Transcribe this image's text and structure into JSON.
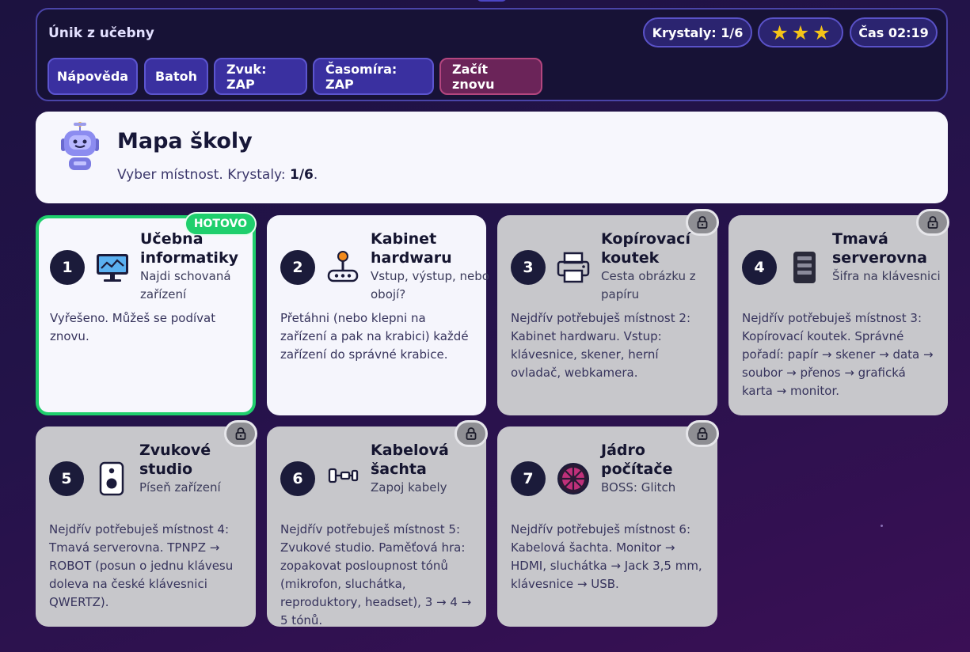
{
  "hud": {
    "title": "Únik z učebny",
    "crystals": "Krystaly: 1/6",
    "stars": [
      "★",
      "★",
      "★"
    ],
    "time": "Čas 02:19",
    "buttons": {
      "help": "Nápověda",
      "backpack": "Batoh",
      "sound": "Zvuk: ZAP",
      "timer": "Časomíra: ZAP",
      "restart": "Začít znovu"
    }
  },
  "intro": {
    "title": "Mapa školy",
    "text_prefix": "Vyber místnost. Krystaly: ",
    "text_value": "1/6",
    "text_suffix": "."
  },
  "rooms": [
    {
      "number": "1",
      "title": "Učebna informatiky",
      "subtitle": "Najdi schovaná zařízení",
      "body": "Vyřešeno. Můžeš se podívat znovu.",
      "status": "done",
      "badge": "HOTOVO",
      "icon": "monitor-icon"
    },
    {
      "number": "2",
      "title": "Kabinet hardwaru",
      "subtitle": "Vstup, výstup, nebo obojí?",
      "body": "Přetáhni (nebo klepni na zařízení a pak na krabici) každé zařízení do správné krabice.",
      "status": "open",
      "icon": "joystick-icon"
    },
    {
      "number": "3",
      "title": "Kopírovací koutek",
      "subtitle": "Cesta obrázku z papíru",
      "body": "Nejdřív potřebuješ místnost 2: Kabinet hardwaru. Vstup: klávesnice, skener, herní ovladač, webkamera.",
      "status": "locked",
      "icon": "printer-icon"
    },
    {
      "number": "4",
      "title": "Tmavá serverovna",
      "subtitle": "Šifra na klávesnici",
      "body": "Nejdřív potřebuješ místnost 3: Kopírovací koutek. Správné pořadí: papír → skener → data → soubor → přenos → grafická karta → monitor.",
      "status": "locked",
      "icon": "server-icon"
    },
    {
      "number": "5",
      "title": "Zvukové studio",
      "subtitle": "Píseň zařízení",
      "body": "Nejdřív potřebuješ místnost 4: Tmavá serverovna. TPNPZ → ROBOT (posun o jednu klávesu doleva na české klávesnici QWERTZ).",
      "status": "locked",
      "icon": "speaker-icon"
    },
    {
      "number": "6",
      "title": "Kabelová šachta",
      "subtitle": "Zapoj kabely",
      "body": "Nejdřív potřebuješ místnost 5: Zvukové studio. Paměťová hra: zopakovat posloupnost tónů (mikrofon, sluchátka, reproduktory, headset), 3 → 4 → 5 tónů.",
      "status": "locked",
      "icon": "cable-plug-icon"
    },
    {
      "number": "7",
      "title": "Jádro počítače",
      "subtitle": "BOSS: Glitch",
      "body": "Nejdřív potřebuješ místnost 6: Kabelová šachta. Monitor → HDMI, sluchátka → Jack 3,5 mm, klávesnice → USB.",
      "status": "locked",
      "icon": "core-fan-icon"
    }
  ]
}
